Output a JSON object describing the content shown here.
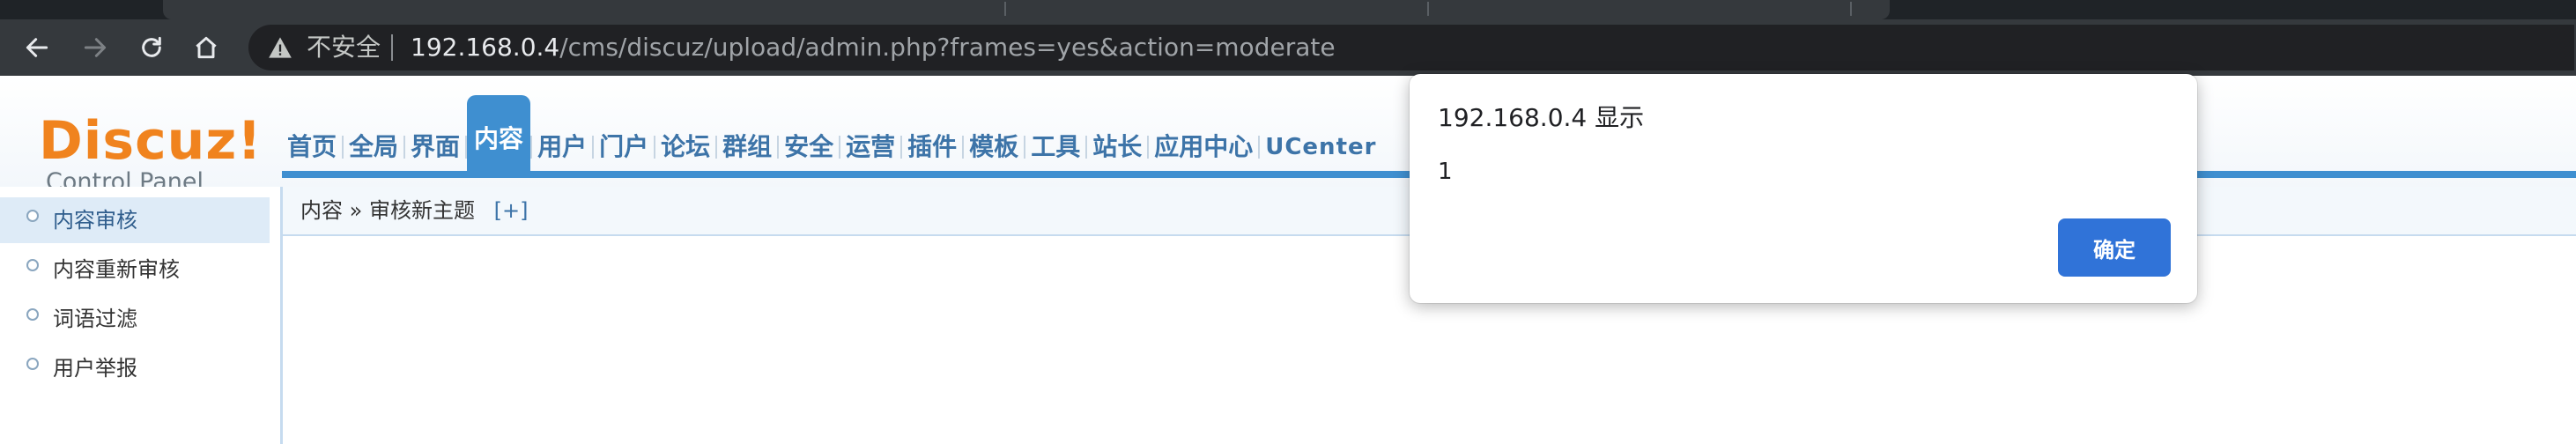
{
  "browser": {
    "insecure_label": "不安全",
    "url_host": "192.168.0.4",
    "url_path": "/cms/discuz/upload/admin.php?frames=yes&action=moderate",
    "icons": [
      "back-arrow-icon",
      "forward-arrow-icon",
      "reload-icon",
      "home-icon",
      "warning-icon"
    ]
  },
  "admin": {
    "logo": {
      "main": "Discuz!",
      "sub": "Control Panel"
    },
    "nav": [
      {
        "label": "首页"
      },
      {
        "label": "全局"
      },
      {
        "label": "界面"
      },
      {
        "label": "内容",
        "active": true
      },
      {
        "label": "用户"
      },
      {
        "label": "门户"
      },
      {
        "label": "论坛"
      },
      {
        "label": "群组"
      },
      {
        "label": "安全"
      },
      {
        "label": "运营"
      },
      {
        "label": "插件"
      },
      {
        "label": "模板"
      },
      {
        "label": "工具"
      },
      {
        "label": "站长"
      },
      {
        "label": "应用中心"
      },
      {
        "label": "UCenter"
      }
    ],
    "breadcrumb": {
      "section": "内容",
      "separator": "»",
      "page": "审核新主题",
      "plus": "[+]"
    },
    "sidebar": [
      {
        "label": "内容审核",
        "active": true
      },
      {
        "label": "内容重新审核"
      },
      {
        "label": "词语过滤"
      },
      {
        "label": "用户举报"
      }
    ]
  },
  "dialog": {
    "title": "192.168.0.4 显示",
    "message": "1",
    "ok_label": "确定"
  },
  "colors": {
    "chrome_bg": "#35393d",
    "omnibox_bg": "#202124",
    "logo_orange": "#f0831e",
    "nav_blue": "#3f8fd0",
    "nav_text": "#3d74a8",
    "dialog_button": "#3073d8"
  }
}
